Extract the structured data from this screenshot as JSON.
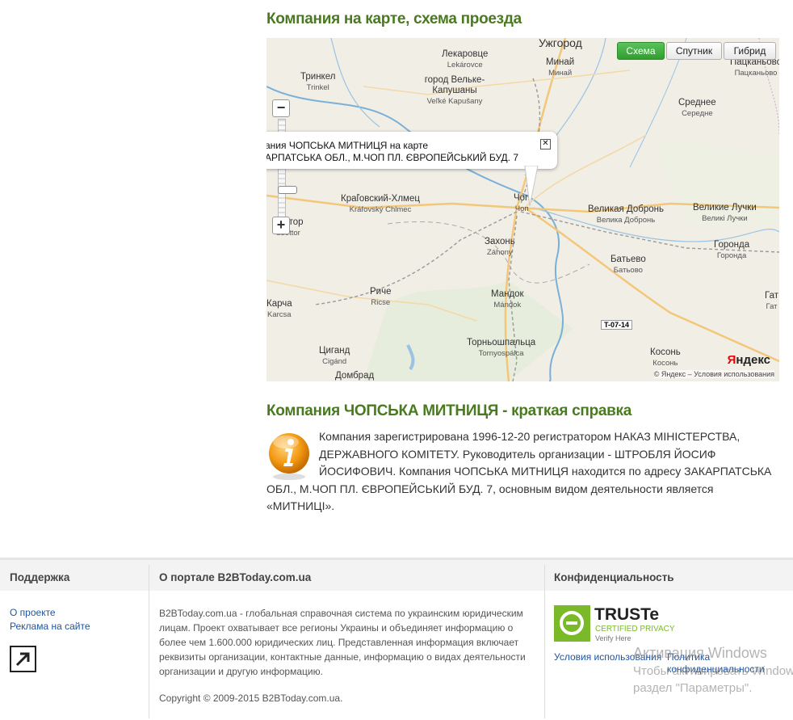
{
  "map_section": {
    "title": "Компания на карте, схема проезда",
    "buttons": {
      "scheme": "Схема",
      "satellite": "Спутник",
      "hybrid": "Гибрид"
    },
    "balloon_line1": "ания ЧОПСЬКА МИТНИЦЯ на карте",
    "balloon_line2": "АРПАТСЬКА ОБЛ., М.ЧОП ПЛ. ЄВРОПЕЙСЬКИЙ БУД. 7",
    "yandex_logo": "Яндекс",
    "copyright": "© Яндекс – Условия использования",
    "road_tag": "T-07-14",
    "places": [
      {
        "name": "Ужгород",
        "sub": ""
      },
      {
        "name": "Лекаровце",
        "sub": "Lekárovce"
      },
      {
        "name": "Минай",
        "sub": "Минай"
      },
      {
        "name": "Пацканьово",
        "sub": "Пацканьово"
      },
      {
        "name": "Тринкел",
        "sub": "Trinkel"
      },
      {
        "name": "город Вельке-Капушаны",
        "sub": "Veľké Kapušany"
      },
      {
        "name": "Среднее",
        "sub": "Середне"
      },
      {
        "name": "Краľовский-Хлмец",
        "sub": "Kráľovský Chlmec"
      },
      {
        "name": "Чоп",
        "sub": "Чоп"
      },
      {
        "name": "Великая Добронь",
        "sub": "Велика Добронь"
      },
      {
        "name": "Великие Лучки",
        "sub": "Великі Лучки"
      },
      {
        "name": "Сеттор",
        "sub": "Szottor"
      },
      {
        "name": "Захонь",
        "sub": "Záhony"
      },
      {
        "name": "Батьево",
        "sub": "Батьово"
      },
      {
        "name": "Горонда",
        "sub": "Горонда"
      },
      {
        "name": "Риче",
        "sub": "Ricse"
      },
      {
        "name": "Мандок",
        "sub": "Mándok"
      },
      {
        "name": "Карча",
        "sub": "Karcsa"
      },
      {
        "name": "Гат",
        "sub": "Гат"
      },
      {
        "name": "Торньошпальца",
        "sub": "Tornyospálca"
      },
      {
        "name": "Циганд",
        "sub": "Cigánd"
      },
      {
        "name": "Косонь",
        "sub": "Косонь"
      },
      {
        "name": "Домбрад",
        "sub": ""
      }
    ]
  },
  "info_section": {
    "title": "Компания ЧОПСЬКА МИТНИЦЯ - краткая справка",
    "text": "Компания зарегистрирована 1996-12-20 регистратором НАКАЗ МІНІСТЕРСТВА, ДЕРЖАВНОГО КОМІТЕТУ. Руководитель организации - ШТРОБЛЯ ЙОСИФ ЙОСИФОВИЧ. Компания ЧОПСЬКА МИТНИЦЯ находится по адресу ЗАКАРПАТСЬКА ОБЛ., М.ЧОП ПЛ. ЄВРОПЕЙСЬКИЙ БУД. 7, основным видом деятельности является «МИТНИЦІ»."
  },
  "footer": {
    "support_title": "Поддержка",
    "about_title": "О портале B2BToday.com.ua",
    "privacy_title": "Конфиденциальность",
    "links": {
      "about": "О проекте",
      "ads": "Реклама на сайте"
    },
    "description": "B2BToday.com.ua - глобальная справочная система по украинским юридическим лицам. Проект охватывает все регионы Украины и объединяет информацию о более чем 1.600.000 юридических лиц. Представленная информация включает реквизиты организации, контактные данные, информацию о видах деятельности организации и другую информацию.",
    "copyright": "Copyright © 2009-2015 B2BToday.com.ua.",
    "truste": {
      "brand": "TRUSTe",
      "line1": "CERTIFIED PRIVACY",
      "line2": "Verify Here"
    },
    "terms_link": "Условия использования",
    "policy_link": "Политика конфиденциальности"
  },
  "watermark": {
    "line1": "Активация Windows",
    "line2": "Чтобы активировать Windows, перейдите в",
    "line3": "раздел \"Параметры\"."
  }
}
